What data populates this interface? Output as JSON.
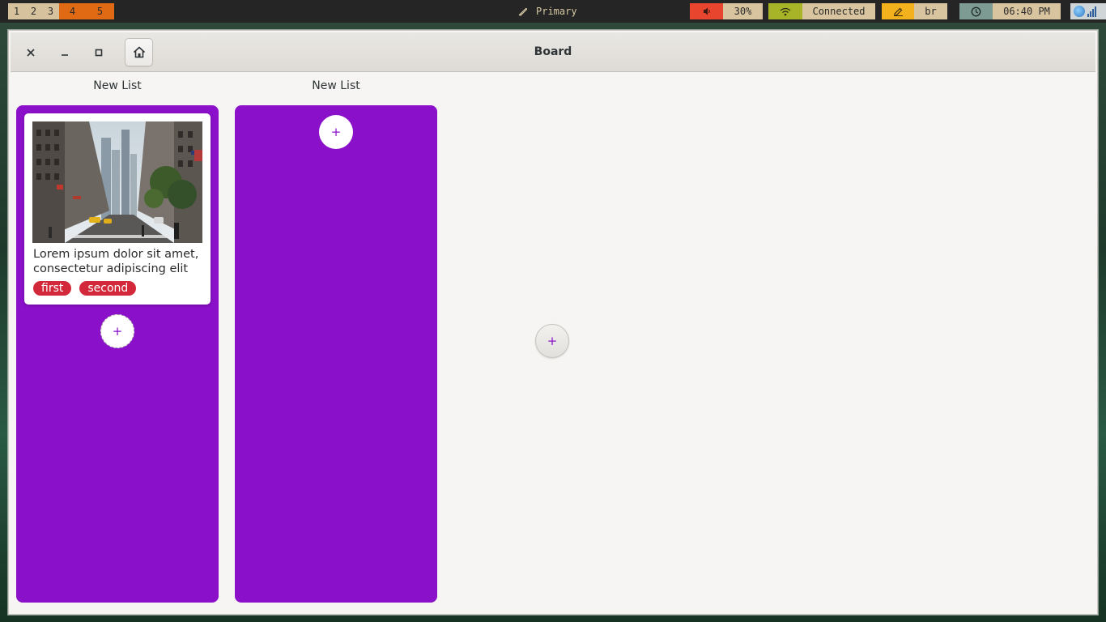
{
  "topbar": {
    "workspaces": [
      "1",
      "2",
      "3",
      "4",
      "5"
    ],
    "active_workspaces": [
      "4",
      "5"
    ],
    "window_title": "Primary",
    "volume": {
      "icon": "speaker-icon",
      "value": "30%"
    },
    "network": {
      "icon": "wifi-icon",
      "status": "Connected"
    },
    "keyboard": {
      "icon": "pencil-icon",
      "layout": "br"
    },
    "clock": {
      "icon": "clock-icon",
      "time": "06:40 PM"
    },
    "tray_icons": [
      "globe-icon",
      "signal-bars-icon"
    ]
  },
  "window": {
    "title": "Board",
    "buttons": [
      "close-icon",
      "minimize-icon",
      "maximize-icon",
      "home-icon"
    ]
  },
  "board": {
    "lists": [
      {
        "title": "New List",
        "cards": [
          {
            "image": "city-street-photo",
            "text": "Lorem ipsum dolor sit amet, consectetur adipiscing elit",
            "tags": [
              "first",
              "second"
            ]
          }
        ],
        "add_label": "+"
      },
      {
        "title": "New List",
        "cards": [],
        "add_label": "+"
      }
    ],
    "add_list_label": "+"
  },
  "colors": {
    "list_background": "#8a10c9",
    "tag_background": "#d2283a",
    "accent_plus": "#8a10c9",
    "volume_bg": "#e8452e",
    "network_bg": "#a8b428",
    "keyboard_bg": "#f3b11e",
    "clock_bg": "#7d9b92",
    "active_workspace_bg": "#e06a14"
  }
}
